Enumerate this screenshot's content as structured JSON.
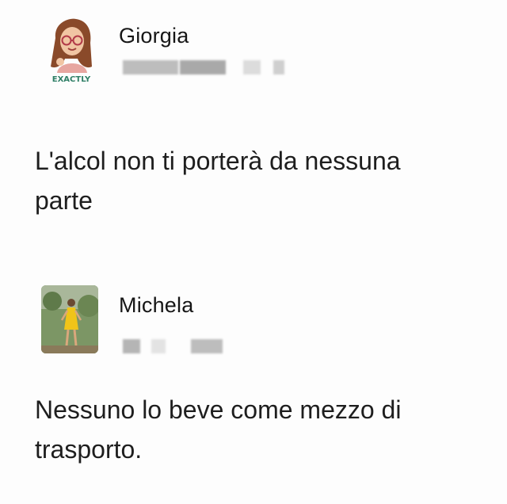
{
  "comments": [
    {
      "author": "Giorgia",
      "avatar_icon": "bitmoji-avatar",
      "avatar_badge": "EXACTLY",
      "text_lines": [
        "L'alcol non ti porterà da nessuna",
        "parte"
      ]
    },
    {
      "author": "Michela",
      "avatar_icon": "photo-avatar",
      "text_lines": [
        "Nessuno lo beve come mezzo di",
        "trasporto."
      ]
    }
  ],
  "colors": {
    "background": "#fdfdfd",
    "text": "#1c1c1c",
    "blurred_meta": "#c9c9c9",
    "badge": "#2f7f66"
  }
}
